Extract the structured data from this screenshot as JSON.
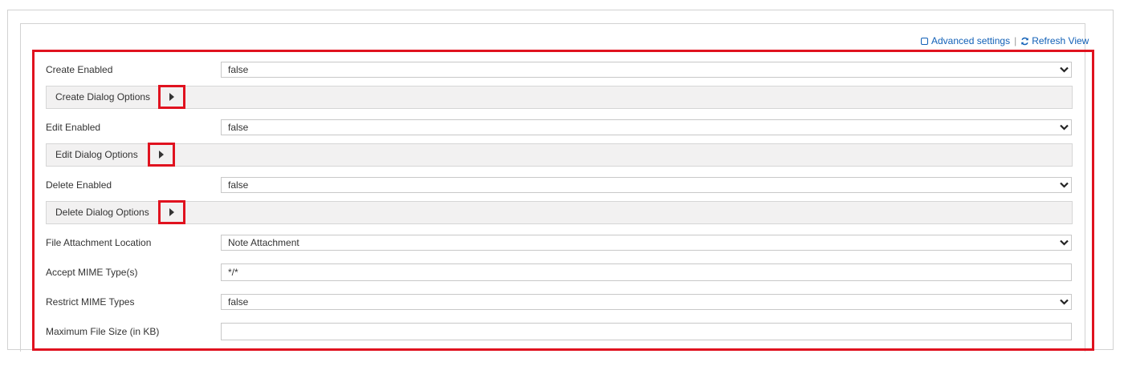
{
  "toolbar": {
    "advanced_settings": "Advanced settings",
    "separator": "|",
    "refresh_view": "Refresh View"
  },
  "form": {
    "create_enabled": {
      "label": "Create Enabled",
      "value": "false"
    },
    "create_dialog": {
      "label": "Create Dialog Options"
    },
    "edit_enabled": {
      "label": "Edit Enabled",
      "value": "false"
    },
    "edit_dialog": {
      "label": "Edit Dialog Options"
    },
    "delete_enabled": {
      "label": "Delete Enabled",
      "value": "false"
    },
    "delete_dialog": {
      "label": "Delete Dialog Options"
    },
    "file_attachment_location": {
      "label": "File Attachment Location",
      "value": "Note Attachment"
    },
    "accept_mime_types": {
      "label": "Accept MIME Type(s)",
      "value": "*/*"
    },
    "restrict_mime_types": {
      "label": "Restrict MIME Types",
      "value": "false"
    },
    "maximum_file_size": {
      "label": "Maximum File Size (in KB)",
      "value": ""
    }
  },
  "colors": {
    "highlight": "#e0121f",
    "link": "#1160b7",
    "section_bg": "#f2f1f1"
  },
  "icons": {
    "advanced": "checkbox-icon",
    "refresh": "refresh-icon",
    "caret": "chevron-down-icon",
    "expand": "expand-arrow-icon"
  }
}
